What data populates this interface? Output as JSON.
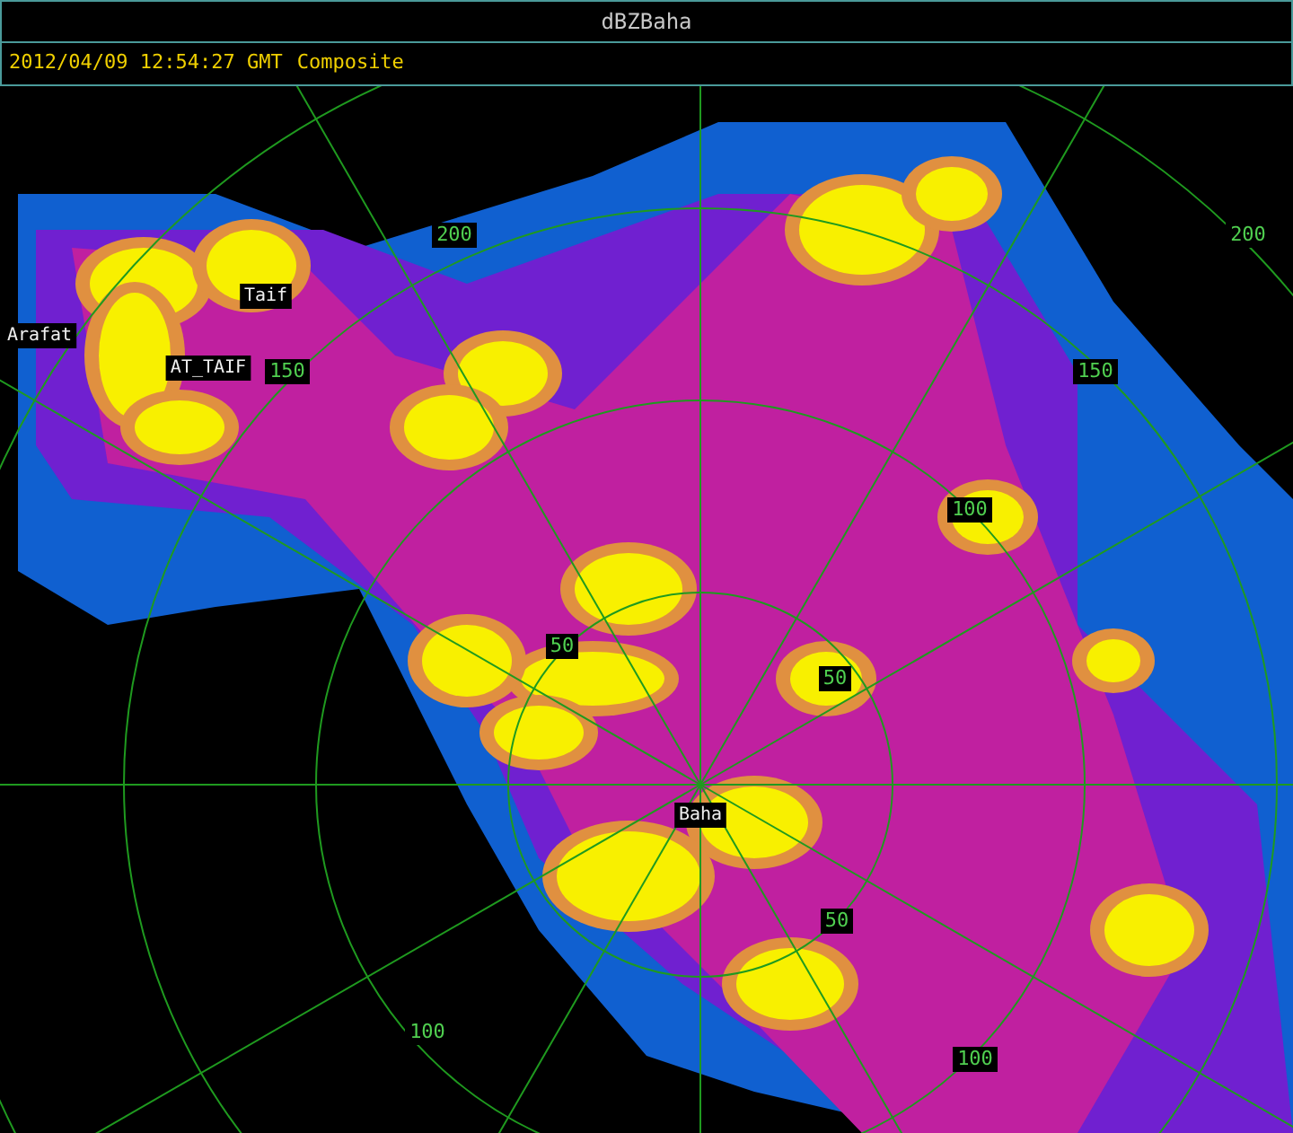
{
  "window": {
    "title": "dBZBaha"
  },
  "header": {
    "timestamp": "2012/04/09 12:54:27 GMT",
    "product": "Composite"
  },
  "radar": {
    "range_labels": [
      {
        "text": "50"
      },
      {
        "text": "50"
      },
      {
        "text": "50"
      },
      {
        "text": "100"
      },
      {
        "text": "100"
      },
      {
        "text": "100"
      },
      {
        "text": "150"
      },
      {
        "text": "150"
      },
      {
        "text": "200"
      },
      {
        "text": "200"
      }
    ],
    "places": [
      {
        "name": "Taif"
      },
      {
        "name": "Arafat"
      },
      {
        "name": "AT_TAIF"
      },
      {
        "name": "Baha"
      }
    ]
  }
}
